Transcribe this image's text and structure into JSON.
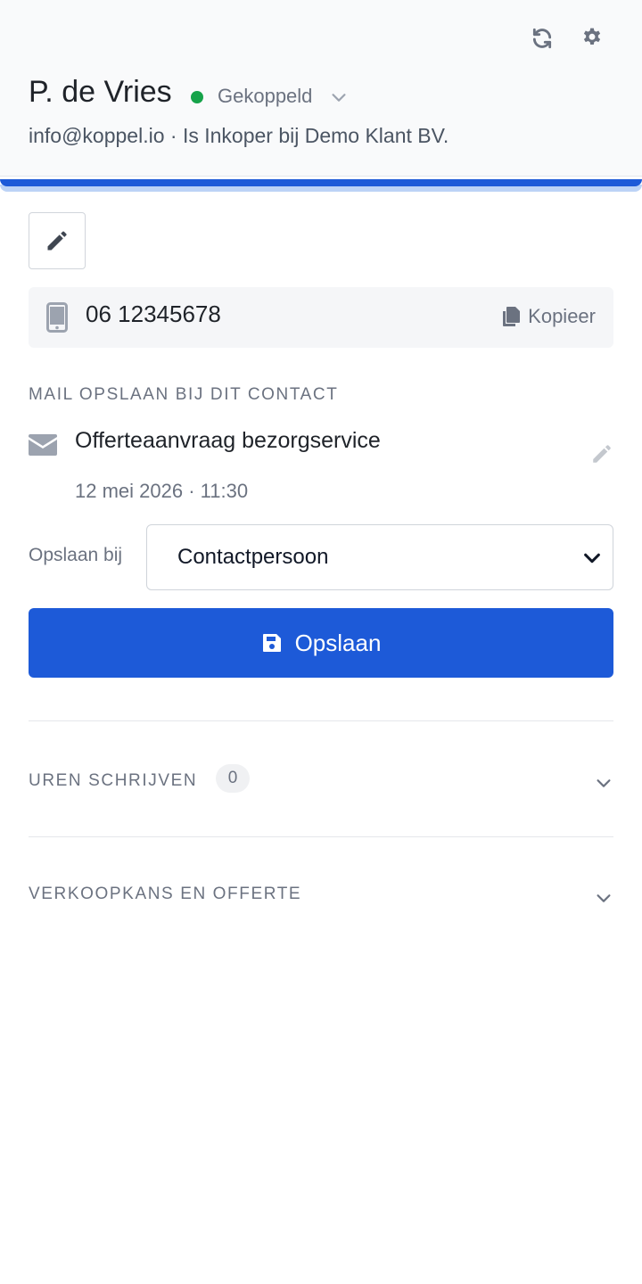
{
  "header": {
    "refresh_icon": "refresh-icon",
    "settings_icon": "gear-icon",
    "contact_name": "P. de Vries",
    "status_label": "Gekoppeld",
    "status_color": "#16a34a",
    "subtitle": "info@koppel.io · Is Inkoper bij Demo Klant BV."
  },
  "phone": {
    "number": "06 12345678",
    "copy_label": "Kopieer"
  },
  "mail_section": {
    "label": "MAIL OPSLAAN BIJ DIT CONTACT",
    "subject": "Offerteaanvraag bezorgservice",
    "datetime": "12 mei 2026 · 11:30",
    "save_at_label": "Opslaan bij",
    "save_at_value": "Contactpersoon",
    "save_button_label": "Opslaan"
  },
  "sections": [
    {
      "label": "UREN SCHRIJVEN",
      "count": "0"
    },
    {
      "label": "VERKOOPKANS EN OFFERTE"
    }
  ],
  "colors": {
    "accent": "#1d5ad8",
    "muted_text": "#6b7280"
  }
}
